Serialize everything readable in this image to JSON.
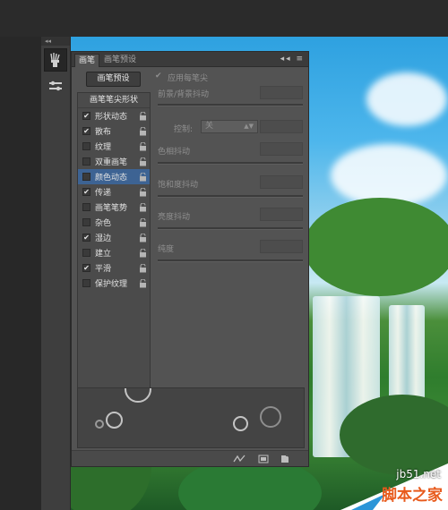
{
  "tool_strip": {
    "tools": [
      {
        "icon": "brush-panel-icon",
        "active": true
      },
      {
        "icon": "brush-presets-icon",
        "active": false
      }
    ]
  },
  "panel": {
    "tabs": [
      {
        "label": "画笔",
        "active": true
      },
      {
        "label": "画笔预设",
        "active": false
      }
    ],
    "brush_presets_button": "画笔预设",
    "list_header": "画笔笔尖形状",
    "items": [
      {
        "label": "形状动态",
        "checked": true,
        "selected": false
      },
      {
        "label": "散布",
        "checked": true,
        "selected": false
      },
      {
        "label": "纹理",
        "checked": false,
        "selected": false
      },
      {
        "label": "双重画笔",
        "checked": false,
        "selected": false
      },
      {
        "label": "颜色动态",
        "checked": false,
        "selected": true
      },
      {
        "label": "传递",
        "checked": true,
        "selected": false
      },
      {
        "label": "画笔笔势",
        "checked": false,
        "selected": false
      },
      {
        "label": "杂色",
        "checked": false,
        "selected": false
      },
      {
        "label": "湿边",
        "checked": true,
        "selected": false
      },
      {
        "label": "建立",
        "checked": false,
        "selected": false
      },
      {
        "label": "平滑",
        "checked": true,
        "selected": false
      },
      {
        "label": "保护纹理",
        "checked": false,
        "selected": false
      }
    ],
    "apply_per_tip_label": "应用每笔尖",
    "apply_per_tip_checked": true,
    "fg_bg_jitter_label": "前景/背景抖动",
    "control_label": "控制:",
    "control_value": "关",
    "hue_jitter_label": "色相抖动",
    "saturation_jitter_label": "饱和度抖动",
    "brightness_jitter_label": "亮度抖动",
    "purity_label": "纯度"
  },
  "watermark": {
    "url": "jb51.net",
    "text": "脚本之家"
  },
  "colors": {
    "panel_bg": "#535353",
    "selected_row": "#3d6393",
    "watermark_orange": "#e85a1c"
  }
}
